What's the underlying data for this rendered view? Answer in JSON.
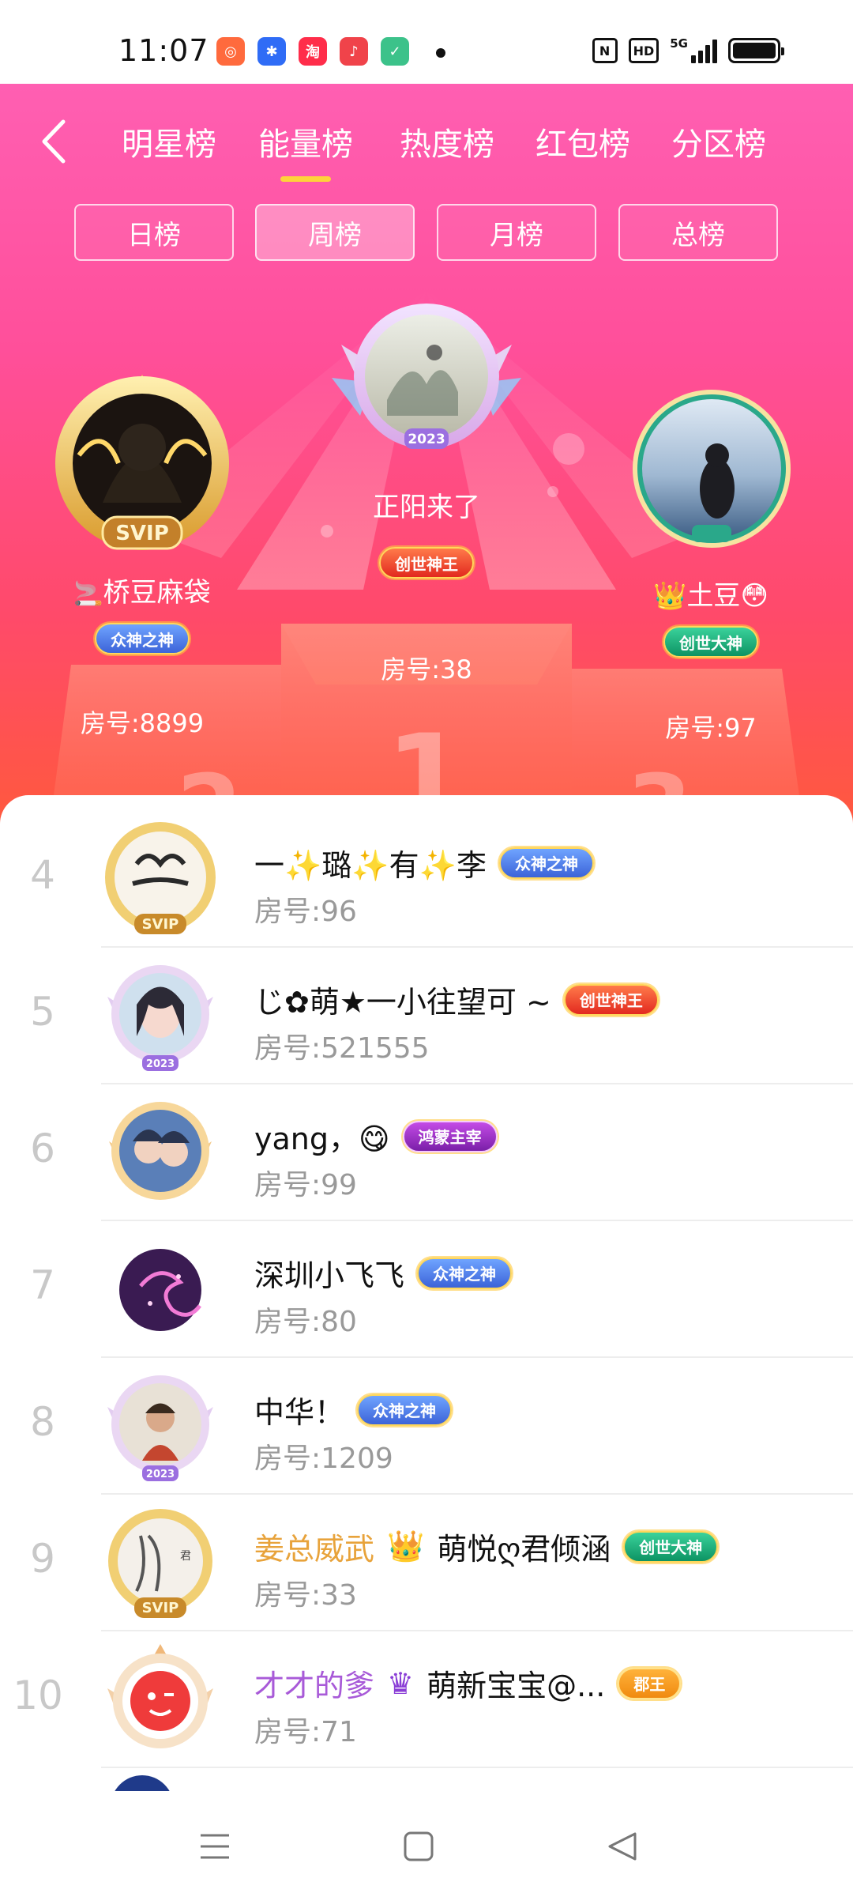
{
  "status_bar": {
    "time": "11:07",
    "apps": [
      {
        "icon": "camera-app-icon",
        "color": "#ff6a3d",
        "glyph": "◎"
      },
      {
        "icon": "baidu-app-icon",
        "color": "#2f6cf6",
        "glyph": "✱"
      },
      {
        "icon": "taote-app-icon",
        "color": "#ff2d4a",
        "glyph": "淘"
      },
      {
        "icon": "music-app-icon",
        "color": "#f0434a",
        "glyph": "♪"
      },
      {
        "icon": "shield-app-icon",
        "color": "#3cc28a",
        "glyph": "✓"
      }
    ],
    "nfc": "N",
    "hd": "HD",
    "network": "5G"
  },
  "header": {
    "main_tabs": [
      "明星榜",
      "能量榜",
      "热度榜",
      "红包榜",
      "分区榜"
    ],
    "active_main_tab": 1,
    "period_tabs": [
      "日榜",
      "周榜",
      "月榜",
      "总榜"
    ],
    "active_period_tab": 1
  },
  "podium": {
    "first": {
      "name": "正阳来了",
      "badge": "创世神王",
      "room": "房号:38",
      "year": "2023"
    },
    "second": {
      "name": "桥豆麻袋",
      "badge": "众神之神",
      "room": "房号:8899",
      "frame_label": "SVIP"
    },
    "third": {
      "name": "土豆",
      "badge": "创世大神",
      "room": "房号:97"
    },
    "pedestal_numbers": [
      "1",
      "2",
      "3"
    ]
  },
  "list": [
    {
      "rank": "4",
      "name": "一✨璐✨有✨李",
      "badge": "众神之神",
      "badge_color": "blue",
      "room": "房号:96",
      "frame": "SVIP"
    },
    {
      "rank": "5",
      "name": "じ✿萌★一小往望可 ~",
      "badge": "创世神王",
      "badge_color": "red",
      "room": "房号:521555",
      "frame": "2023"
    },
    {
      "rank": "6",
      "name": "yang，😋",
      "badge": "鸿蒙主宰",
      "badge_color": "purple",
      "room": "房号:99",
      "frame": ""
    },
    {
      "rank": "7",
      "name": "深圳小飞飞",
      "badge": "众神之神",
      "badge_color": "blue",
      "room": "房号:80",
      "frame": ""
    },
    {
      "rank": "8",
      "name": "中华！",
      "badge": "众神之神",
      "badge_color": "blue",
      "room": "房号:1209",
      "frame": "2023"
    },
    {
      "rank": "9",
      "prefix": "姜总威武",
      "name": "萌悦ღ君倾涵",
      "badge": "创世大神",
      "badge_color": "green",
      "room": "房号:33",
      "frame": "SVIP"
    },
    {
      "rank": "10",
      "prefix": "才才的爹",
      "name": "萌新宝宝@...",
      "badge": "郡王",
      "badge_color": "orange",
      "room": "房号:71",
      "frame": ""
    }
  ]
}
